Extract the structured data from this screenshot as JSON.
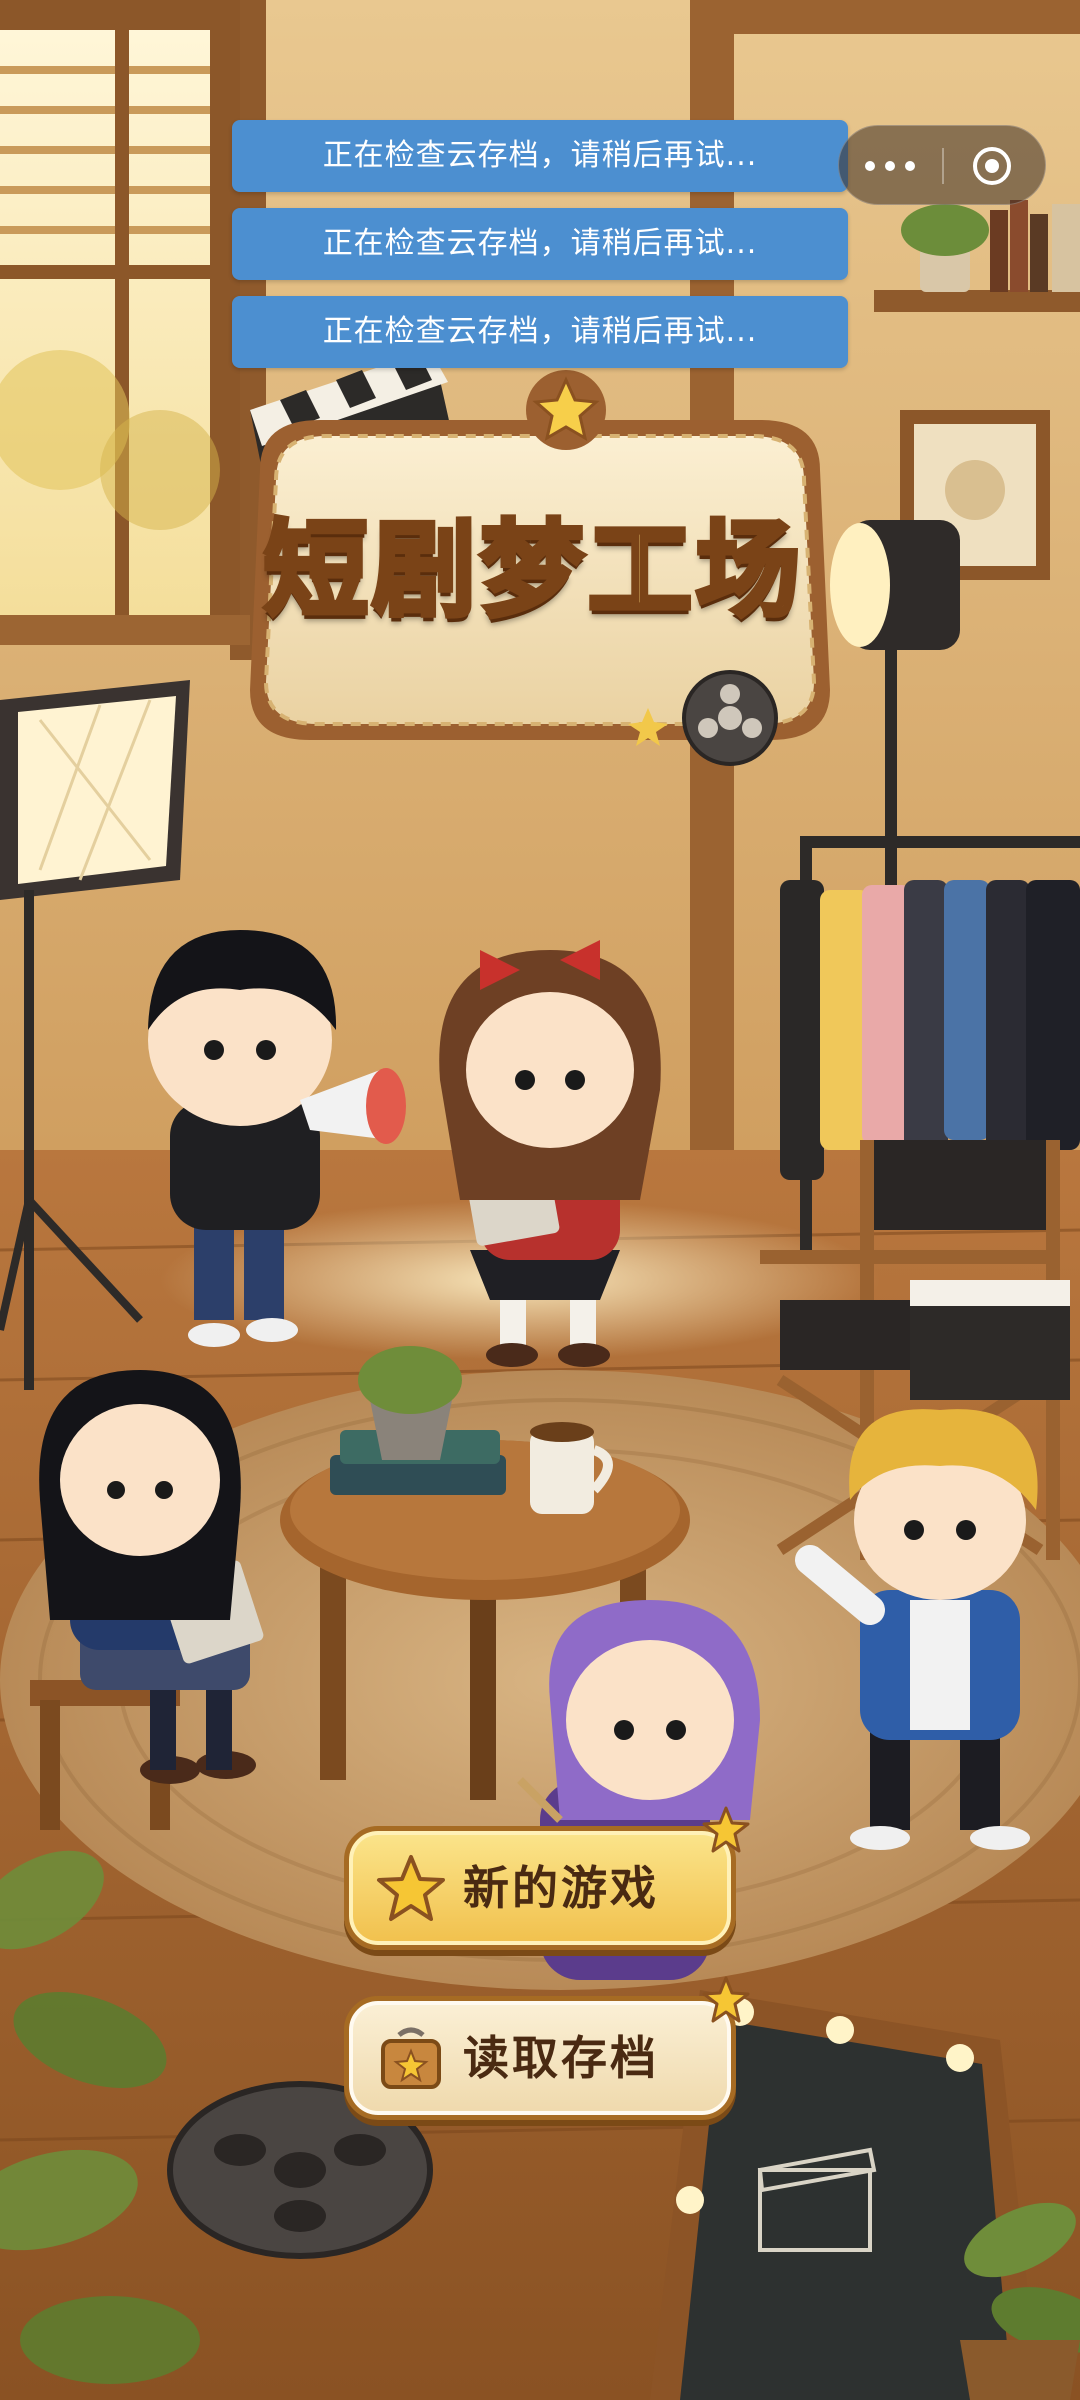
{
  "toasts": [
    {
      "text": "正在检查云存档，请稍后再试..."
    },
    {
      "text": "正在检查云存档，请稍后再试..."
    },
    {
      "text": "正在检查云存档，请稍后再试..."
    }
  ],
  "capsule": {
    "more_icon": "more-dots-icon",
    "close_icon": "miniprogram-close-icon"
  },
  "title": {
    "text": "短剧梦工场"
  },
  "menu": {
    "new_game_label": "新的游戏",
    "new_game_icon": "star-icon",
    "load_save_label": "读取存档",
    "load_save_icon": "save-folder-icon"
  },
  "colors": {
    "toast_bg": "#4c8fd0",
    "title_fill": "#f9d77a",
    "title_outline": "#7a4317",
    "button_gold": "#f1c04c",
    "button_cream": "#efd9ac"
  }
}
